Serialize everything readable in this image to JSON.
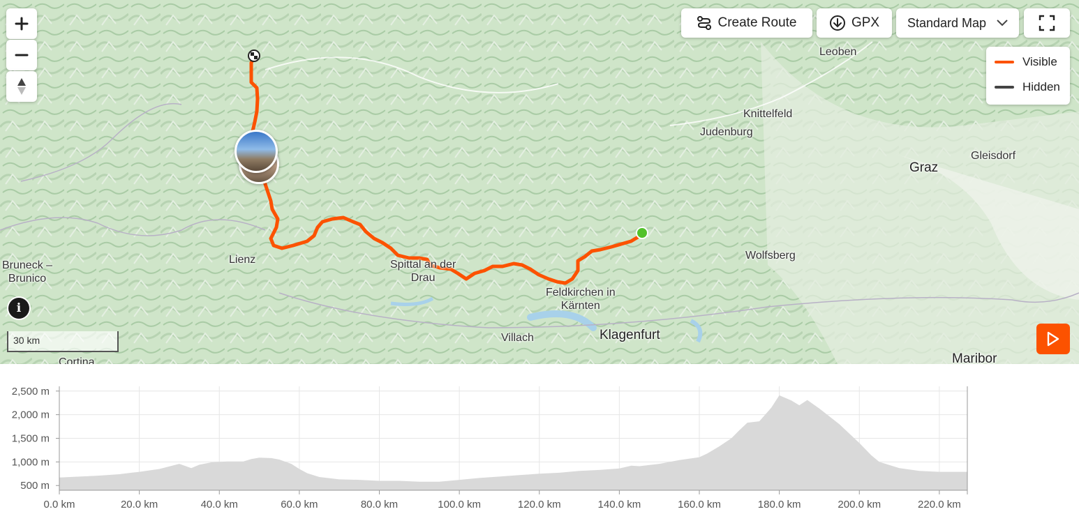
{
  "controls": {
    "zoom_in": "+",
    "zoom_out": "−",
    "create_route_label": "Create Route",
    "gpx_label": "GPX",
    "map_style_label": "Standard Map",
    "icons": {
      "zoom_in": "plus-icon",
      "zoom_out": "minus-icon",
      "compass": "compass-icon",
      "create_route": "route-icon",
      "gpx": "download-icon",
      "map_style": "chevron-down-icon",
      "fullscreen": "fullscreen-icon",
      "info": "info-icon",
      "play": "play-icon"
    }
  },
  "legend": [
    {
      "label": "Visible",
      "color": "#fc5200"
    },
    {
      "label": "Hidden",
      "color": "#444444"
    }
  ],
  "places": [
    {
      "id": "leoben",
      "name": "Leoben"
    },
    {
      "id": "knittelfeld",
      "name": "Knittelfeld"
    },
    {
      "id": "judenburg",
      "name": "Judenburg"
    },
    {
      "id": "graz",
      "name": "Graz"
    },
    {
      "id": "gleisdorf",
      "name": "Gleisdorf"
    },
    {
      "id": "wolfsberg",
      "name": "Wolfsberg"
    },
    {
      "id": "lienz",
      "name": "Lienz"
    },
    {
      "id": "bruneck",
      "name": "Bruneck –\nBrunico"
    },
    {
      "id": "spittal",
      "name": "Spittal an der\nDrau"
    },
    {
      "id": "feldkirchen",
      "name": "Feldkirchen in\nKärnten"
    },
    {
      "id": "villach",
      "name": "Villach"
    },
    {
      "id": "klagenfurt",
      "name": "Klagenfurt"
    },
    {
      "id": "cortina",
      "name": "Cortina"
    },
    {
      "id": "maribor",
      "name": "Maribor"
    }
  ],
  "scale_label": "30 km",
  "colors": {
    "route": "#fc5200",
    "start": "#53c22b",
    "terrain": "#cfe5c9",
    "profile_fill": "#d9d9d9"
  },
  "elevation": {
    "unit_y": "m",
    "unit_x": "km",
    "y_ticks": [
      "2,500 m",
      "2,000 m",
      "1,500 m",
      "1,000 m",
      "500 m"
    ],
    "x_ticks": [
      "0.0 km",
      "20.0 km",
      "40.0 km",
      "60.0 km",
      "80.0 km",
      "100.0 km",
      "120.0 km",
      "140.0 km",
      "160.0 km",
      "180.0 km",
      "200.0 km",
      "220.0 km"
    ],
    "y_range": [
      400,
      2600
    ],
    "x_range": [
      0,
      227
    ]
  },
  "chart_data": {
    "type": "area",
    "title": "",
    "xlabel": "",
    "ylabel": "",
    "xlim": [
      0,
      227
    ],
    "ylim": [
      400,
      2600
    ],
    "grid": true,
    "x": [
      0,
      5,
      10,
      15,
      18,
      20,
      25,
      30,
      33,
      35,
      38,
      42,
      46,
      48,
      50,
      53,
      55,
      58,
      60,
      62,
      65,
      70,
      75,
      80,
      85,
      90,
      95,
      100,
      105,
      110,
      115,
      120,
      125,
      130,
      135,
      140,
      143,
      145,
      150,
      155,
      160,
      162,
      165,
      168,
      170,
      172,
      175,
      178,
      180,
      183,
      185,
      187,
      190,
      195,
      200,
      203,
      205,
      210,
      215,
      220,
      227
    ],
    "values": [
      670,
      690,
      710,
      740,
      770,
      790,
      850,
      960,
      870,
      940,
      990,
      1010,
      1010,
      1060,
      1090,
      1080,
      1050,
      960,
      850,
      760,
      680,
      630,
      620,
      600,
      600,
      580,
      580,
      620,
      660,
      690,
      720,
      750,
      770,
      810,
      830,
      860,
      920,
      910,
      960,
      1040,
      1100,
      1180,
      1330,
      1500,
      1670,
      1830,
      1860,
      2150,
      2410,
      2300,
      2200,
      2310,
      2130,
      1800,
      1400,
      1140,
      1000,
      870,
      810,
      790,
      790
    ]
  }
}
